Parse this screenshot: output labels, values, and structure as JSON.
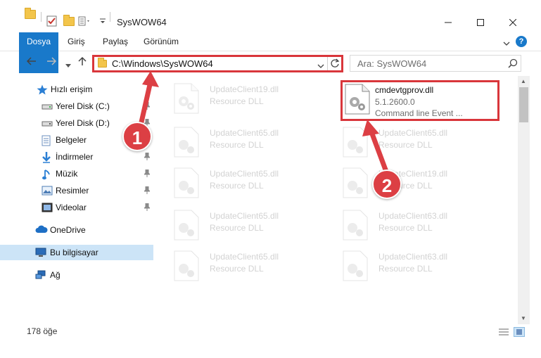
{
  "window": {
    "title": "SysWOW64",
    "controls": {
      "minimize_icon": "minimize-icon",
      "maximize_icon": "maximize-icon",
      "close_icon": "close-icon"
    }
  },
  "ribbon": {
    "tabs": [
      {
        "label": "Dosya",
        "active": true
      },
      {
        "label": "Giriş"
      },
      {
        "label": "Paylaş"
      },
      {
        "label": "Görünüm"
      }
    ],
    "help_label": "?"
  },
  "address": {
    "path": "C:\\Windows\\SysWOW64",
    "search_placeholder": "Ara: SysWOW64"
  },
  "sidebar": {
    "items": [
      {
        "label": "Hızlı erişim",
        "icon": "star-icon"
      },
      {
        "label": "Yerel Disk (C:)",
        "icon": "drive-icon",
        "pinned": true
      },
      {
        "label": "Yerel Disk (D:)",
        "icon": "drive-icon",
        "pinned": true
      },
      {
        "label": "Belgeler",
        "icon": "documents-icon",
        "pinned": true
      },
      {
        "label": "İndirmeler",
        "icon": "download-icon",
        "pinned": true
      },
      {
        "label": "Müzik",
        "icon": "music-icon",
        "pinned": true
      },
      {
        "label": "Resimler",
        "icon": "pictures-icon",
        "pinned": true
      },
      {
        "label": "Videolar",
        "icon": "videos-icon",
        "pinned": true
      },
      {
        "label": "OneDrive",
        "icon": "cloud-icon"
      },
      {
        "label": "Bu bilgisayar",
        "icon": "computer-icon",
        "selected": true
      },
      {
        "label": "Ağ",
        "icon": "network-icon"
      }
    ]
  },
  "files": [
    {
      "name": "UpdateClient19.dll",
      "desc": "Resource DLL"
    },
    {
      "name": "cmdevtgprov.dll",
      "version": "5.1.2600.0",
      "desc": "Command line Event ...",
      "highlighted": true
    },
    {
      "name": "UpdateClient65.dll",
      "desc": "Resource DLL"
    },
    {
      "name": "UpdateClient65.dll",
      "desc": "Resource DLL"
    },
    {
      "name": "UpdateClient65.dll",
      "desc": "Resource DLL"
    },
    {
      "name": "UpdateClient19.dll",
      "desc": "Resource DLL"
    },
    {
      "name": "UpdateClient65.dll",
      "desc": "Resource DLL"
    },
    {
      "name": "UpdateClient63.dll",
      "desc": "Resource DLL"
    },
    {
      "name": "UpdateClient65.dll",
      "desc": "Resource DLL"
    },
    {
      "name": "UpdateClient63.dll",
      "desc": "Resource DLL"
    }
  ],
  "status": {
    "item_count": "178 öğe"
  },
  "callouts": [
    {
      "label": "1"
    },
    {
      "label": "2"
    }
  ],
  "colors": {
    "accent": "#1979ca",
    "highlight": "#d9363b",
    "selected_bg": "#cce4f7"
  }
}
